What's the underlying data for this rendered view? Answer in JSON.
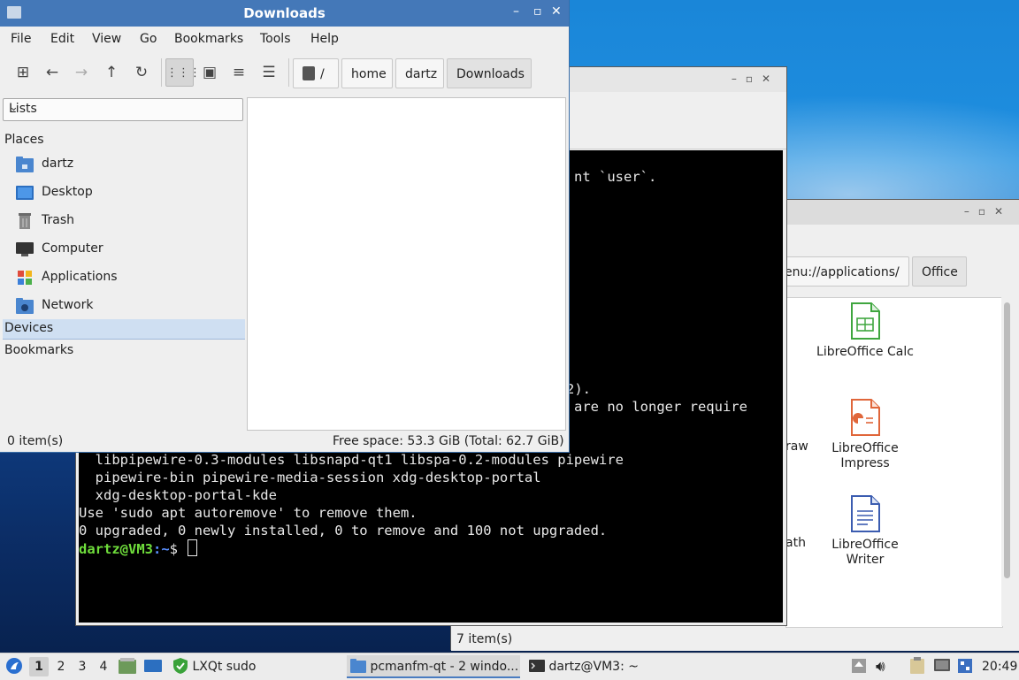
{
  "apps_window": {
    "path_segment": "enu://applications/",
    "path_current": "Office",
    "items": [
      {
        "label": "LibreOffice Calc",
        "color": "#3fa63f"
      },
      {
        "label": "LibreOffice Impress",
        "color": "#e0663a"
      },
      {
        "label": "LibreOffice Writer",
        "color": "#3b5cb0"
      }
    ],
    "partial_labels": [
      "raw",
      "ath"
    ],
    "status": "7 item(s)"
  },
  "terminal": {
    "lines_partial_top": [
      "nt `user`."
    ],
    "line_mid_1": "2).",
    "line_mid_2": "are no longer require",
    "lines": [
      "  libpipewire-0.3-modules libsnapd-qt1 libspa-0.2-modules pipewire",
      "  pipewire-bin pipewire-media-session xdg-desktop-portal",
      "  xdg-desktop-portal-kde",
      "Use 'sudo apt autoremove' to remove them.",
      "0 upgraded, 0 newly installed, 0 to remove and 100 not upgraded."
    ],
    "prompt_user": "dartz@VM3",
    "prompt_path": ":~",
    "prompt_symbol": "$ "
  },
  "downloads": {
    "title": "Downloads",
    "menu": [
      "File",
      "Edit",
      "View",
      "Go",
      "Bookmarks",
      "Tools",
      "Help"
    ],
    "breadcrumb": [
      "/",
      "home",
      "dartz",
      "Downloads"
    ],
    "side_mode": "Lists",
    "places_header": "Places",
    "places": [
      {
        "label": "dartz",
        "icon": "home-folder-icon"
      },
      {
        "label": "Desktop",
        "icon": "desktop-icon"
      },
      {
        "label": "Trash",
        "icon": "trash-icon"
      },
      {
        "label": "Computer",
        "icon": "computer-icon"
      },
      {
        "label": "Applications",
        "icon": "applications-icon"
      },
      {
        "label": "Network",
        "icon": "network-icon"
      }
    ],
    "devices_header": "Devices",
    "bookmarks_header": "Bookmarks",
    "status_left": "0 item(s)",
    "status_right": "Free space: 53.3 GiB (Total: 62.7 GiB)"
  },
  "taskbar": {
    "workspaces": [
      "1",
      "2",
      "3",
      "4"
    ],
    "sudo_label": "LXQt sudo",
    "tasks": [
      "pcmanfm-qt - 2 windo...",
      "dartz@VM3: ~"
    ],
    "clock": "20:49"
  },
  "colors": {
    "title_active": "#4478b8",
    "selection": "#cfdff2",
    "prompt_user": "#6fdd3b",
    "prompt_path": "#5a8fff"
  }
}
